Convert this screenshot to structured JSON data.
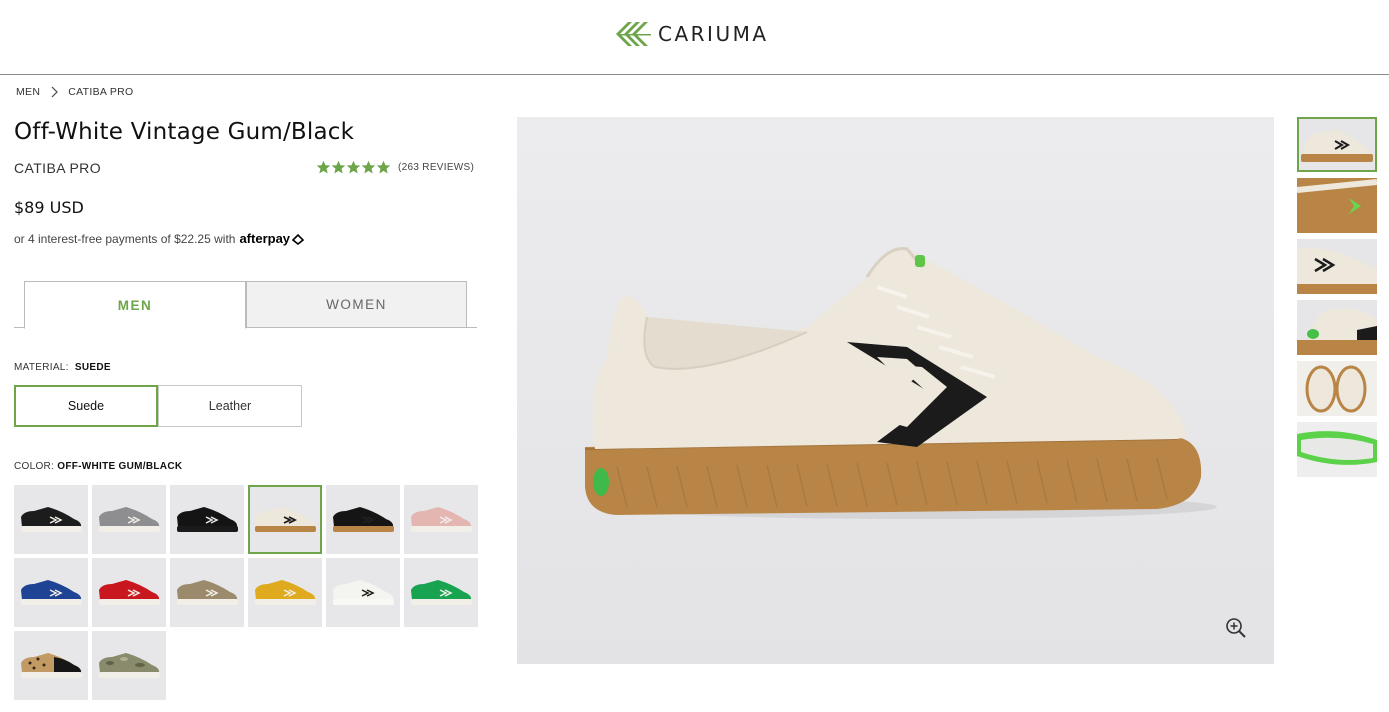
{
  "header": {
    "brand": "CARIUMA",
    "logo_icon": "cariuma-leaf-icon",
    "brand_color": "#6ea54a"
  },
  "breadcrumb": {
    "items": [
      "MEN",
      "CATIBA PRO"
    ]
  },
  "product": {
    "title": "Off-White Vintage Gum/Black",
    "collection": "CATIBA PRO",
    "rating_stars": 5,
    "reviews": "(263 REVIEWS)",
    "price": "$89 USD",
    "installments_text": "or 4 interest-free payments of $22.25 with",
    "afterpay_label": "afterpay"
  },
  "gender_tabs": {
    "men": "MEN",
    "women": "WOMEN",
    "selected": "MEN"
  },
  "material": {
    "label": "MATERIAL:",
    "selected": "SUEDE",
    "options": [
      "Suede",
      "Leather"
    ]
  },
  "color": {
    "label": "COLOR:",
    "selected": "OFF-WHITE GUM/BLACK",
    "swatch_count": 14,
    "selected_index": 3
  },
  "gallery": {
    "thumbnail_count": 6,
    "selected_index": 0,
    "zoom_icon": "zoom-in-icon"
  },
  "colors": {
    "accent": "#6ea54a",
    "gum": "#b98546",
    "canvas": "#ede7dc",
    "stripe": "#1b1b1b"
  }
}
